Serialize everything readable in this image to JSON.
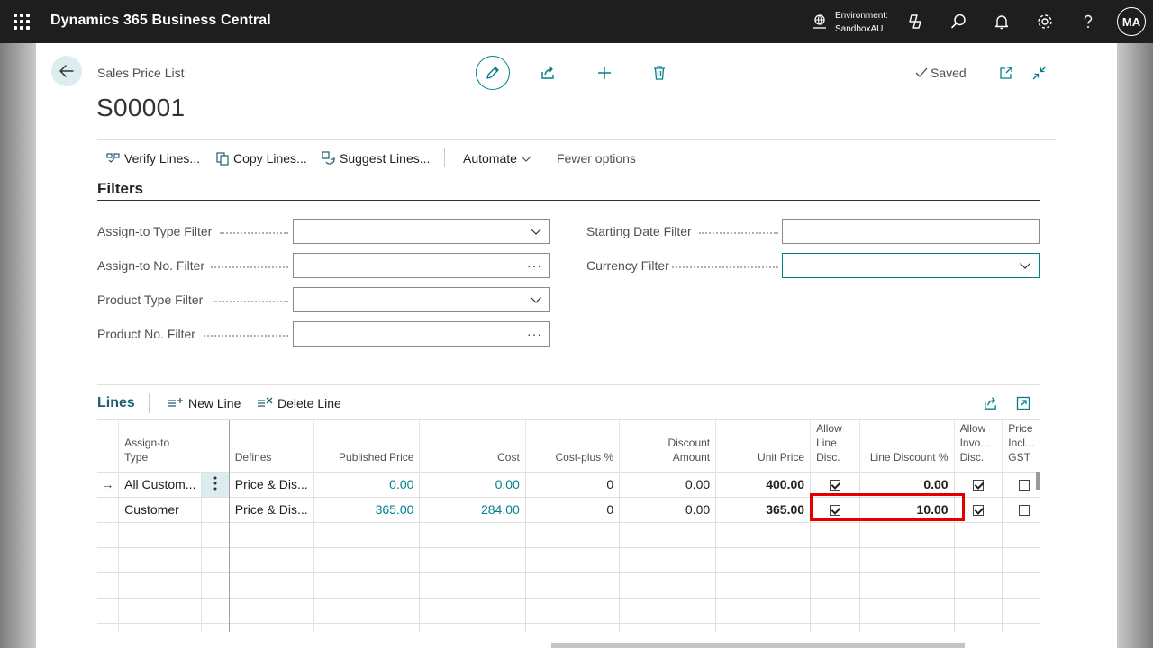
{
  "app": {
    "title": "Dynamics 365 Business Central",
    "environment_label": "Environment:",
    "environment_name": "SandboxAU",
    "user_initials": "MA"
  },
  "page": {
    "caption": "Sales Price List",
    "title": "S00001",
    "saved_label": "Saved"
  },
  "actions": {
    "verify": "Verify Lines...",
    "copy": "Copy Lines...",
    "suggest": "Suggest Lines...",
    "automate": "Automate",
    "fewer": "Fewer options"
  },
  "filters": {
    "title": "Filters",
    "assign_type": {
      "label": "Assign-to Type Filter",
      "value": ""
    },
    "assign_no": {
      "label": "Assign-to No. Filter",
      "value": ""
    },
    "product_type": {
      "label": "Product Type Filter",
      "value": ""
    },
    "product_no": {
      "label": "Product No. Filter",
      "value": ""
    },
    "starting_date": {
      "label": "Starting Date Filter",
      "value": ""
    },
    "currency": {
      "label": "Currency Filter",
      "value": ""
    }
  },
  "lines": {
    "title": "Lines",
    "new_line": "New Line",
    "delete_line": "Delete Line",
    "columns": {
      "assign_type": [
        "Assign-to",
        "Type"
      ],
      "defines": "Defines",
      "published_price": "Published Price",
      "cost": "Cost",
      "cost_plus": "Cost-plus %",
      "discount_amount": [
        "Discount",
        "Amount"
      ],
      "unit_price": "Unit Price",
      "allow_line_disc": [
        "Allow",
        "Line",
        "Disc."
      ],
      "line_discount": "Line Discount %",
      "allow_invoice_disc": [
        "Allow",
        "Invo...",
        "Disc."
      ],
      "price_incl_gst": [
        "Price",
        "Incl...",
        "GST"
      ]
    },
    "rows": [
      {
        "assign_type": "All Custom...",
        "defines": "Price & Dis...",
        "published_price": "0.00",
        "cost": "0.00",
        "cost_plus": "0",
        "discount_amount": "0.00",
        "unit_price": "400.00",
        "allow_line_disc": true,
        "line_discount": "0.00",
        "allow_invoice_disc": true,
        "price_incl_gst": false
      },
      {
        "assign_type": "Customer",
        "defines": "Price & Dis...",
        "published_price": "365.00",
        "cost": "284.00",
        "cost_plus": "0",
        "discount_amount": "0.00",
        "unit_price": "365.00",
        "allow_line_disc": true,
        "line_discount": "10.00",
        "allow_invoice_disc": true,
        "price_incl_gst": false
      }
    ]
  },
  "colors": {
    "accent": "#00818a",
    "highlight": "#e00000",
    "topbar": "#1e1e1e"
  }
}
